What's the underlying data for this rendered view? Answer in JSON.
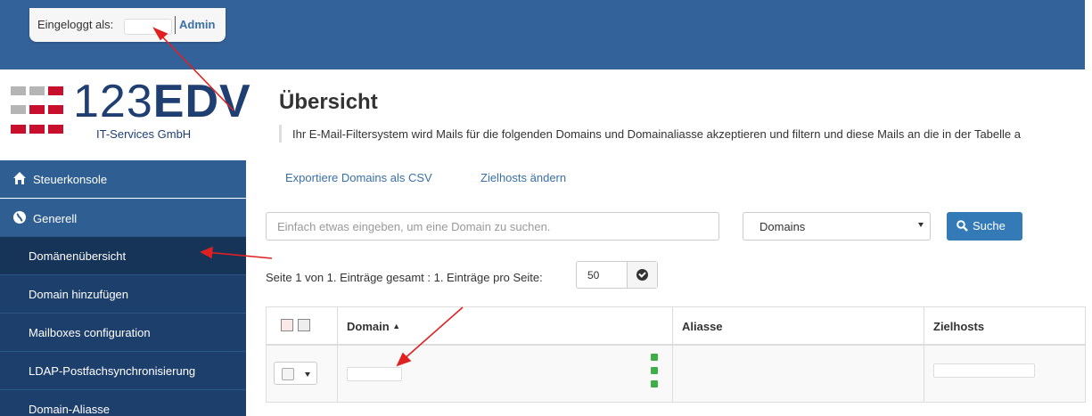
{
  "header": {
    "login_label": "Eingeloggt als:",
    "role": "Admin"
  },
  "logo": {
    "name_light": "123",
    "name_bold": "EDV",
    "subtitle": "IT-Services GmbH"
  },
  "sidebar": {
    "items": [
      {
        "label": "Steuerkonsole",
        "icon": "home-icon"
      },
      {
        "label": "Generell",
        "icon": "globe-icon"
      },
      {
        "label": "Domänenübersicht",
        "active": true
      },
      {
        "label": "Domain hinzufügen"
      },
      {
        "label": "Mailboxes configuration"
      },
      {
        "label": "LDAP-Postfachsynchronisierung"
      },
      {
        "label": "Domain-Aliasse"
      }
    ]
  },
  "main": {
    "title": "Übersicht",
    "description": "Ihr E-Mail-Filtersystem wird Mails für die folgenden Domains und Domainaliasse akzeptieren und filtern und diese Mails an die in der Tabelle a",
    "links": {
      "export": "Exportiere Domains als CSV",
      "zielhosts": "Zielhosts ändern"
    },
    "search": {
      "placeholder": "Einfach etwas eingeben, um eine Domain zu suchen.",
      "scope_selected": "Domains",
      "button": "Suche"
    },
    "paging": {
      "text": "Seite 1 von 1. Einträge gesamt : 1. Einträge pro Seite:",
      "per_page": "50"
    },
    "table": {
      "columns": [
        "Domain",
        "Aliasse",
        "Zielhosts"
      ],
      "sort_indicator": "▲"
    }
  },
  "colors": {
    "topbar": "#336199",
    "sidebar": "#1d3f6c",
    "accent": "#337ab7",
    "annotation_arrow": "#e02020"
  }
}
